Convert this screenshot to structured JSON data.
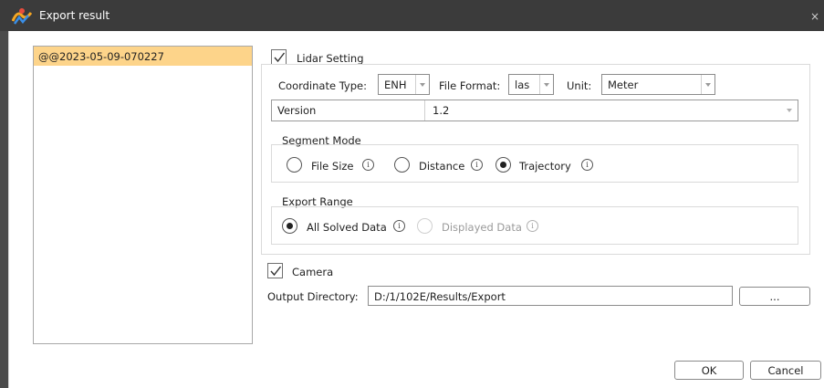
{
  "window": {
    "title": "Export result",
    "close_glyph": "×",
    "logo_icon": "app-logo-icon"
  },
  "list": {
    "items": [
      "@@2023-05-09-070227"
    ]
  },
  "lidar": {
    "checkbox_label": "Lidar Setting",
    "checked": true,
    "coordinate_type_label": "Coordinate Type:",
    "coordinate_type_value": "ENH",
    "file_format_label": "File Format:",
    "file_format_value": "las",
    "unit_label": "Unit:",
    "unit_value": "Meter",
    "version_label": "Version",
    "version_value": "1.2",
    "segment_mode": {
      "title": "Segment Mode",
      "options": [
        "File Size",
        "Distance",
        "Trajectory"
      ],
      "selected": "Trajectory"
    },
    "export_range": {
      "title": "Export Range",
      "options": [
        "All Solved Data",
        "Displayed Data"
      ],
      "selected": "All Solved Data",
      "disabled": [
        "Displayed Data"
      ]
    }
  },
  "camera": {
    "checkbox_label": "Camera",
    "checked": true
  },
  "output": {
    "label": "Output Directory:",
    "path": "D:/1/102E/Results/Export",
    "browse_label": "..."
  },
  "buttons": {
    "ok": "OK",
    "cancel": "Cancel"
  },
  "icons": {
    "info": "i"
  },
  "colors": {
    "titlebar": "#3b3b3b",
    "selection": "#fdd48a"
  }
}
